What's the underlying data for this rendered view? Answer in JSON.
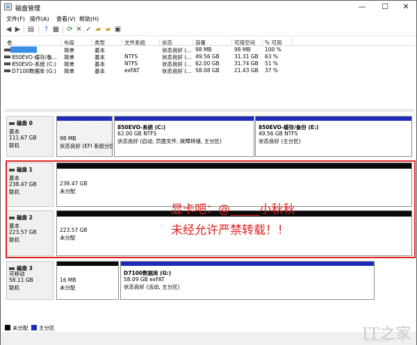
{
  "window": {
    "title": "磁盘管理",
    "minimize": "—",
    "maximize": "☐",
    "close": "✕"
  },
  "menu": [
    "文件(F)",
    "操作(A)",
    "查看(V)",
    "帮助(H)"
  ],
  "toolbar": [
    "back-icon",
    "forward-icon",
    "list-view-icon",
    "help-icon",
    "properties-icon",
    "refresh-icon",
    "delete-icon",
    "check-icon",
    "open-folder-icon",
    "explore-icon",
    "console-icon"
  ],
  "volume_table": {
    "headers": [
      "卷",
      "布局",
      "类型",
      "文件系统",
      "状态",
      "容量",
      "可用空间",
      "% 可用"
    ],
    "rows": [
      {
        "name": "",
        "layout": "简单",
        "type": "基本",
        "fs": "",
        "status": "状态良好 (...",
        "capacity": "98 MB",
        "free": "98 MB",
        "pct": "100 %"
      },
      {
        "name": "850EVO-缓存/备...",
        "layout": "简单",
        "type": "基本",
        "fs": "NTFS",
        "status": "状态良好 (...",
        "capacity": "49.56 GB",
        "free": "31.31 GB",
        "pct": "63 %"
      },
      {
        "name": "850EVO-系统 (C:)",
        "layout": "简单",
        "type": "基本",
        "fs": "NTFS",
        "status": "状态良好 (...",
        "capacity": "62.00 GB",
        "free": "31.74 GB",
        "pct": "51 %"
      },
      {
        "name": "D7100数据库 (G:)",
        "layout": "简单",
        "type": "基本",
        "fs": "exFAT",
        "status": "状态良好 (...",
        "capacity": "58.08 GB",
        "free": "21.43 GB",
        "pct": "37 %"
      }
    ]
  },
  "disks": [
    {
      "name": "磁盘 0",
      "type": "基本",
      "size": "111.67 GB",
      "state": "联机",
      "parts": [
        {
          "title": "",
          "line1": "98 MB",
          "line2": "状态良好 (EFI 系统分区)"
        },
        {
          "title": "850EVO-系统 (C:)",
          "line1": "62.00 GB NTFS",
          "line2": "状态良好 (启动, 页面文件, 故障转储, 主分区)"
        },
        {
          "title": "850EVO-缓存/备份 (E:)",
          "line1": "49.56 GB NTFS",
          "line2": "状态良好 (主分区)"
        }
      ]
    },
    {
      "name": "磁盘 1",
      "type": "基本",
      "size": "238.47 GB",
      "state": "联机",
      "parts": [
        {
          "title": "",
          "line1": "238.47 GB",
          "line2": "未分配"
        }
      ]
    },
    {
      "name": "磁盘 2",
      "type": "基本",
      "size": "223.57 GB",
      "state": "联机",
      "parts": [
        {
          "title": "",
          "line1": "223.57 GB",
          "line2": "未分配"
        }
      ]
    },
    {
      "name": "磁盘 3",
      "type": "可移动",
      "size": "58.11 GB",
      "state": "联机",
      "parts": [
        {
          "title": "",
          "line1": "16 MB",
          "line2": "未分配"
        },
        {
          "title": "D7100数据库 (G:)",
          "line1": "58.09 GB exFAT",
          "line2": "状态良好 (活动, 主分区)"
        }
      ]
    }
  ],
  "watermark": {
    "line1": "显卡吧：@_____小秋秋",
    "line2": "未经允许严禁转载！！"
  },
  "legend": [
    {
      "label": "未分配",
      "color": "#0a0a0a"
    },
    {
      "label": "主分区",
      "color": "#1e2bb8"
    }
  ],
  "logo": {
    "text": "IT之家",
    "sub": "ithome.com"
  }
}
